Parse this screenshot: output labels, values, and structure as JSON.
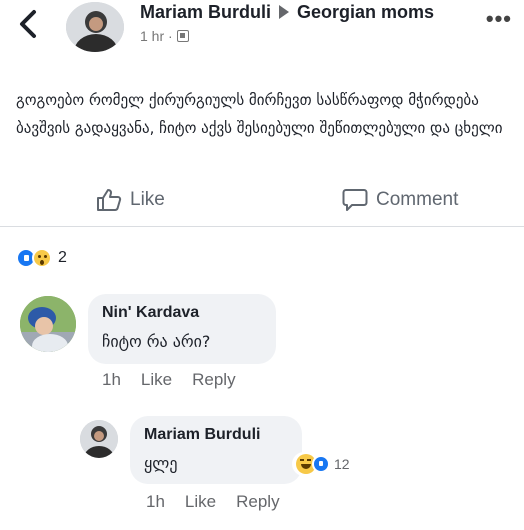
{
  "post": {
    "author": "Mariam Burduli",
    "group": "Georgian moms",
    "time": "1 hr ·",
    "text": "გოგოებო რომელ ქირურგიულს მირჩევთ სასწრაფოდ მჭირდება ბავშვის გადაყვანა, ჩიტო აქვს შესიებული შეწითლებული და ცხელი",
    "icons": {
      "back": "chevron-left-icon",
      "more": "more-options-icon",
      "privacy": "group-privacy-icon"
    }
  },
  "actions": {
    "like_label": "Like",
    "comment_label": "Comment"
  },
  "reactions": {
    "count": "2",
    "types": [
      "like",
      "wow"
    ]
  },
  "comments": [
    {
      "author": "Nin' Kardava",
      "text": "ჩიტო რა არი?",
      "time": "1h",
      "like_label": "Like",
      "reply_label": "Reply"
    },
    {
      "author": "Mariam Burduli",
      "text": "ყლე",
      "time": "1h",
      "like_label": "Like",
      "reply_label": "Reply",
      "reaction_count": "12",
      "reaction_types": [
        "haha",
        "like"
      ]
    }
  ],
  "colors": {
    "accent": "#1877f2",
    "bubble": "#f0f2f5",
    "muted": "#65676b"
  }
}
